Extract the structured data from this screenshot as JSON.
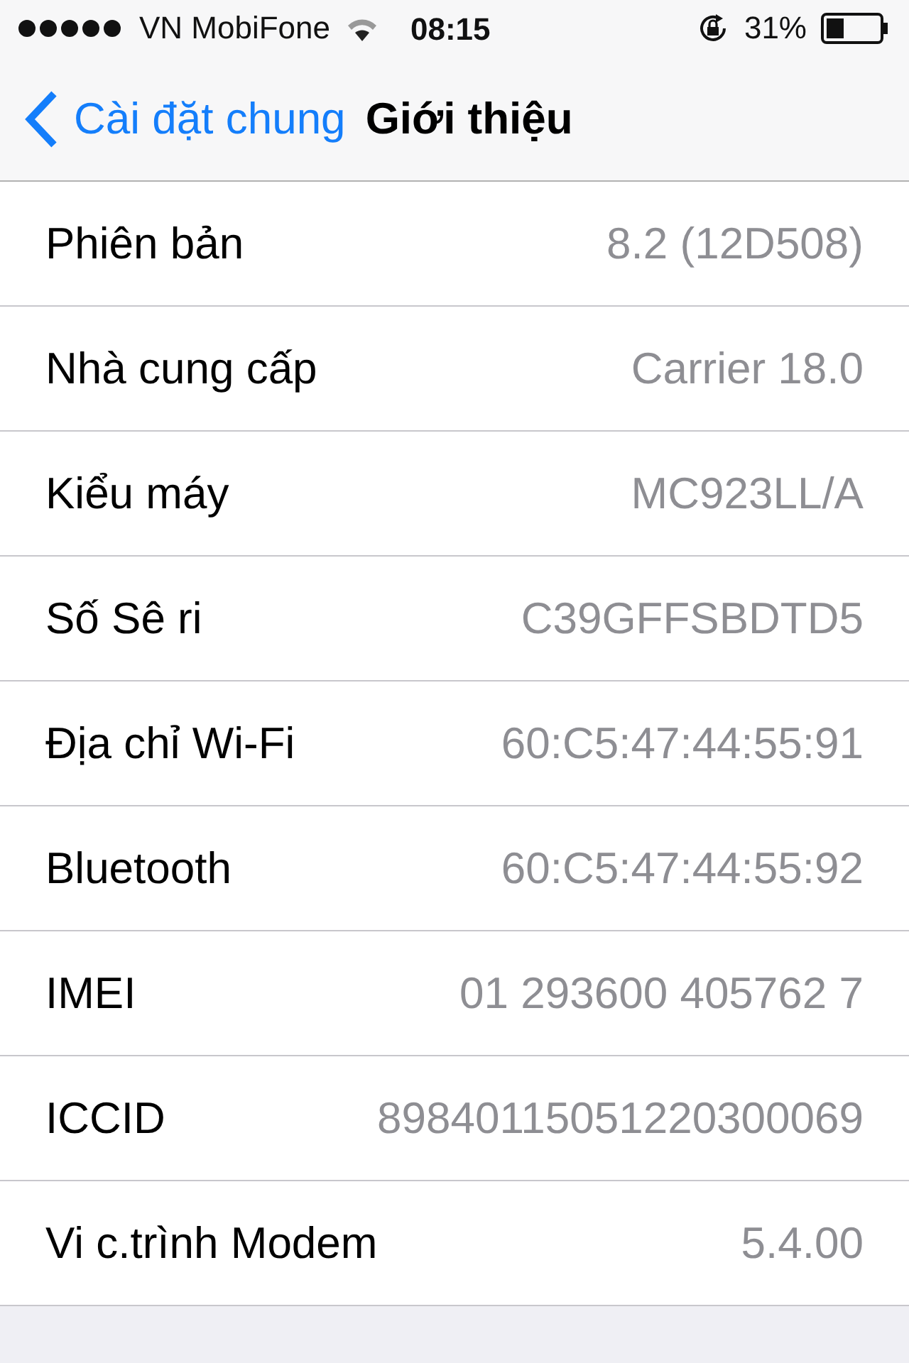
{
  "status_bar": {
    "carrier": "VN MobiFone",
    "time": "08:15",
    "battery": "31%"
  },
  "nav": {
    "back": "Cài đặt chung",
    "title": "Giới thiệu"
  },
  "rows": [
    {
      "label": "Phiên bản",
      "value": "8.2 (12D508)"
    },
    {
      "label": "Nhà cung cấp",
      "value": "Carrier 18.0"
    },
    {
      "label": "Kiểu máy",
      "value": "MC923LL/A"
    },
    {
      "label": "Số Sê ri",
      "value": "C39GFFSBDTD5"
    },
    {
      "label": "Địa chỉ Wi-Fi",
      "value": "60:C5:47:44:55:91"
    },
    {
      "label": "Bluetooth",
      "value": "60:C5:47:44:55:92"
    },
    {
      "label": "IMEI",
      "value": "01 293600 405762 7"
    },
    {
      "label": "ICCID",
      "value": "89840115051220300069"
    },
    {
      "label": "Vi c.trình Modem",
      "value": "5.4.00"
    }
  ]
}
